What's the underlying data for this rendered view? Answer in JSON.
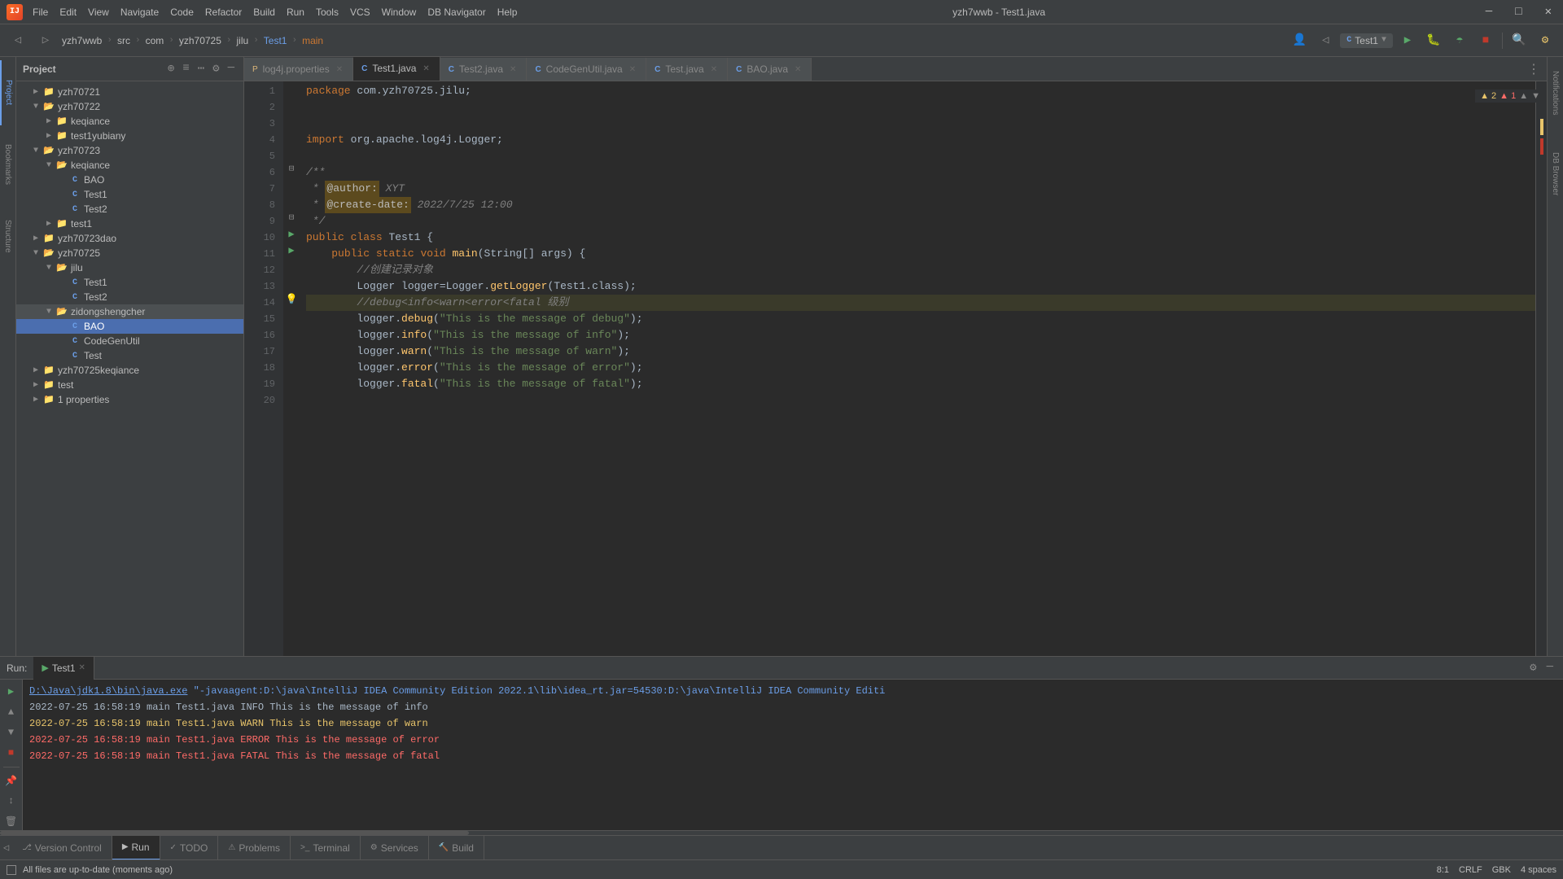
{
  "window": {
    "title": "yzh7wwb - Test1.java",
    "logo": "IJ"
  },
  "menu": {
    "items": [
      "File",
      "Edit",
      "View",
      "Navigate",
      "Code",
      "Refactor",
      "Build",
      "Run",
      "Tools",
      "VCS",
      "Window",
      "DB Navigator",
      "Help"
    ]
  },
  "breadcrumb": {
    "items": [
      "yzh7wwb",
      "src",
      "com",
      "yzh70725",
      "jilu",
      "Test1",
      "main"
    ]
  },
  "tabs": [
    {
      "label": "log4j.properties",
      "type": "prop",
      "active": false
    },
    {
      "label": "Test1.java",
      "type": "java",
      "active": true
    },
    {
      "label": "Test2.java",
      "type": "java",
      "active": false
    },
    {
      "label": "CodeGenUtil.java",
      "type": "java",
      "active": false
    },
    {
      "label": "Test.java",
      "type": "java",
      "active": false
    },
    {
      "label": "BAO.java",
      "type": "java",
      "active": false
    }
  ],
  "editor": {
    "lines": [
      {
        "num": 1,
        "content": "package com.yzh70725.jilu;",
        "type": "normal"
      },
      {
        "num": 2,
        "content": "",
        "type": "normal"
      },
      {
        "num": 3,
        "content": "",
        "type": "normal"
      },
      {
        "num": 4,
        "content": "import org.apache.log4j.Logger;",
        "type": "normal"
      },
      {
        "num": 5,
        "content": "",
        "type": "normal"
      },
      {
        "num": 6,
        "content": "/**",
        "type": "comment"
      },
      {
        "num": 7,
        "content": " * @author: XYT",
        "type": "annotation"
      },
      {
        "num": 8,
        "content": " * @create-date: 2022/7/25 12:00",
        "type": "annotation"
      },
      {
        "num": 9,
        "content": " */",
        "type": "comment"
      },
      {
        "num": 10,
        "content": "public class Test1 {",
        "type": "normal"
      },
      {
        "num": 11,
        "content": "    public static void main(String[] args) {",
        "type": "normal"
      },
      {
        "num": 12,
        "content": "        //创建记录对象",
        "type": "comment"
      },
      {
        "num": 13,
        "content": "        Logger logger=Logger.getLogger(Test1.class);",
        "type": "normal"
      },
      {
        "num": 14,
        "content": "        //debug<info<warn<error<fatal 级别",
        "type": "highlighted"
      },
      {
        "num": 15,
        "content": "        logger.debug(\"This is the message of debug\");",
        "type": "normal"
      },
      {
        "num": 16,
        "content": "        logger.info(\"This is the message of info\");",
        "type": "normal"
      },
      {
        "num": 17,
        "content": "        logger.warn(\"This is the message of warn\");",
        "type": "normal"
      },
      {
        "num": 18,
        "content": "        logger.error(\"This is the message of error\");",
        "type": "normal"
      },
      {
        "num": 19,
        "content": "        logger.fatal(\"This is the message of fatal\");",
        "type": "normal"
      },
      {
        "num": 20,
        "content": "",
        "type": "normal"
      }
    ],
    "warnings": "▲ 2",
    "errors": "▲ 1"
  },
  "project_tree": {
    "items": [
      {
        "label": "yzh70721",
        "type": "folder",
        "level": 1,
        "expanded": false
      },
      {
        "label": "yzh70722",
        "type": "folder",
        "level": 1,
        "expanded": true
      },
      {
        "label": "keqiance",
        "type": "folder",
        "level": 2,
        "expanded": false
      },
      {
        "label": "test1yubiany",
        "type": "folder",
        "level": 2,
        "expanded": false
      },
      {
        "label": "yzh70723",
        "type": "folder",
        "level": 1,
        "expanded": true
      },
      {
        "label": "keqiance",
        "type": "folder",
        "level": 2,
        "expanded": true
      },
      {
        "label": "BAO",
        "type": "java",
        "level": 3
      },
      {
        "label": "Test1",
        "type": "java",
        "level": 3
      },
      {
        "label": "Test2",
        "type": "java",
        "level": 3
      },
      {
        "label": "test1",
        "type": "folder",
        "level": 2,
        "expanded": false
      },
      {
        "label": "yzh70723dao",
        "type": "folder",
        "level": 1,
        "expanded": false
      },
      {
        "label": "yzh70725",
        "type": "folder",
        "level": 1,
        "expanded": true
      },
      {
        "label": "jilu",
        "type": "folder",
        "level": 2,
        "expanded": true
      },
      {
        "label": "Test1",
        "type": "java",
        "level": 3
      },
      {
        "label": "Test2",
        "type": "java",
        "level": 3
      },
      {
        "label": "zidongshengcher",
        "type": "folder",
        "level": 2,
        "expanded": true,
        "selected": false
      },
      {
        "label": "BAO",
        "type": "java",
        "level": 3,
        "selected": true
      },
      {
        "label": "CodeGenUtil",
        "type": "java",
        "level": 3
      },
      {
        "label": "Test",
        "type": "java",
        "level": 3
      },
      {
        "label": "yzh70725keqiance",
        "type": "folder",
        "level": 1,
        "expanded": false
      },
      {
        "label": "test",
        "type": "folder",
        "level": 1,
        "expanded": false
      },
      {
        "label": "1 properties",
        "type": "folder",
        "level": 1,
        "expanded": false
      }
    ]
  },
  "run_panel": {
    "label": "Run:",
    "tab_name": "Test1",
    "output_lines": [
      {
        "text": "D:\\Java\\jdk1.8\\bin\\java.exe \"-javaagent:D:\\java\\IntelliJ IDEA Community Edition 2022.1\\lib\\idea_rt.jar=54530:D:\\java\\IntelliJ IDEA Community Editi",
        "type": "cmd"
      },
      {
        "text": "2022-07-25 16:58:19 main Test1.java INFO This is the message of info",
        "type": "info"
      },
      {
        "text": "2022-07-25 16:58:19 main Test1.java WARN This is the message of warn",
        "type": "warn"
      },
      {
        "text": "2022-07-25 16:58:19 main Test1.java ERROR This is the message of error",
        "type": "error"
      },
      {
        "text": "2022-07-25 16:58:19 main Test1.java FATAL This is the message of fatal",
        "type": "fatal"
      }
    ]
  },
  "bottom_tabs": [
    {
      "label": "Version Control",
      "icon": "⎇",
      "active": false
    },
    {
      "label": "Run",
      "icon": "▶",
      "active": true
    },
    {
      "label": "TODO",
      "icon": "✓",
      "active": false
    },
    {
      "label": "Problems",
      "icon": "⚠",
      "active": false
    },
    {
      "label": "Terminal",
      "icon": ">_",
      "active": false
    },
    {
      "label": "Services",
      "icon": "⚙",
      "active": false
    },
    {
      "label": "Build",
      "icon": "🔨",
      "active": false
    }
  ],
  "status_bar": {
    "message": "All files are up-to-date (moments ago)",
    "position": "8:1",
    "encoding": "CRLF",
    "charset": "GBK",
    "indent": "4 spaces"
  },
  "sidebar_panels": {
    "left": [
      "Project",
      "Structure",
      "Bookmarks"
    ],
    "right": [
      "Notifications",
      "DB Browser"
    ]
  }
}
